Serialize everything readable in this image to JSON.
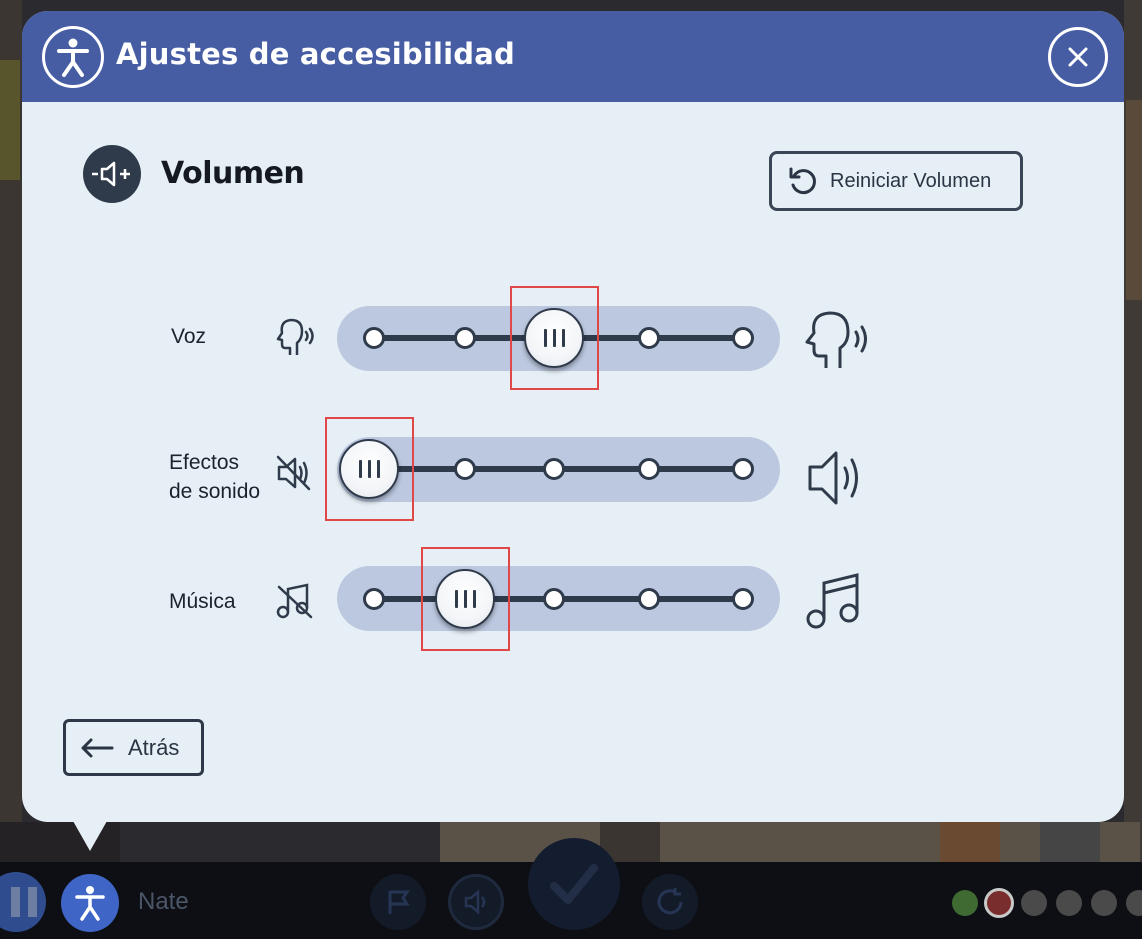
{
  "dialog": {
    "title": "Ajustes de accesibilidad",
    "section_title": "Volumen",
    "reset_label": "Reiniciar Volumen",
    "back_label": "Atrás"
  },
  "sliders": [
    {
      "label_line1": "Voz",
      "label_line2": "",
      "selected_step": 3,
      "steps": 5,
      "min_icon": "head-speaking-small-icon",
      "max_icon": "head-speaking-icon"
    },
    {
      "label_line1": "Efectos",
      "label_line2": "de sonido",
      "selected_step": 1,
      "steps": 5,
      "min_icon": "speaker-muted-icon",
      "max_icon": "speaker-loud-icon"
    },
    {
      "label_line1": "Música",
      "label_line2": "",
      "selected_step": 2,
      "steps": 5,
      "min_icon": "music-muted-icon",
      "max_icon": "music-note-icon"
    }
  ],
  "bottombar": {
    "player_name": "Nate",
    "progress_dots": [
      {
        "color": "#3f6b33"
      },
      {
        "color": "#7a2d2d"
      },
      {
        "color": "#4a4a4a"
      },
      {
        "color": "#4a4a4a"
      },
      {
        "color": "#4a4a4a"
      },
      {
        "color": "#4a4a4a"
      }
    ]
  },
  "colors": {
    "header": "#465da3",
    "dialog_bg": "#e6eff5",
    "track_bg": "#bcc8e0",
    "dark": "#2f3b4b",
    "highlight": "#e04848"
  }
}
